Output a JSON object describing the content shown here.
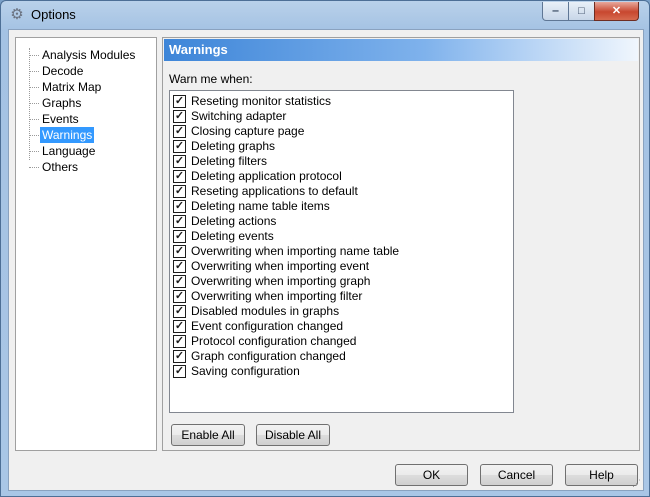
{
  "window": {
    "title": "Options",
    "minimize": "‒",
    "maximize": "□",
    "close": "✕"
  },
  "tree": {
    "items": [
      {
        "label": "Analysis Modules",
        "selected": false
      },
      {
        "label": "Decode",
        "selected": false
      },
      {
        "label": "Matrix Map",
        "selected": false
      },
      {
        "label": "Graphs",
        "selected": false
      },
      {
        "label": "Events",
        "selected": false
      },
      {
        "label": "Warnings",
        "selected": true
      },
      {
        "label": "Language",
        "selected": false
      },
      {
        "label": "Others",
        "selected": false
      }
    ]
  },
  "panel": {
    "header": "Warnings",
    "warn_label": "Warn me when:",
    "check_mark": "✓",
    "items": [
      {
        "label": "Reseting monitor statistics",
        "checked": true
      },
      {
        "label": "Switching adapter",
        "checked": true
      },
      {
        "label": "Closing capture page",
        "checked": true
      },
      {
        "label": "Deleting graphs",
        "checked": true
      },
      {
        "label": "Deleting filters",
        "checked": true
      },
      {
        "label": "Deleting application protocol",
        "checked": true
      },
      {
        "label": "Reseting applications to default",
        "checked": true
      },
      {
        "label": "Deleting name table items",
        "checked": true
      },
      {
        "label": "Deleting actions",
        "checked": true
      },
      {
        "label": "Deleting events",
        "checked": true
      },
      {
        "label": "Overwriting when importing name table",
        "checked": true
      },
      {
        "label": "Overwriting when importing event",
        "checked": true
      },
      {
        "label": "Overwriting when importing graph",
        "checked": true
      },
      {
        "label": "Overwriting when importing filter",
        "checked": true
      },
      {
        "label": "Disabled modules in graphs",
        "checked": true
      },
      {
        "label": "Event configuration changed",
        "checked": true
      },
      {
        "label": "Protocol configuration changed",
        "checked": true
      },
      {
        "label": "Graph configuration changed",
        "checked": true
      },
      {
        "label": "Saving configuration",
        "checked": true
      }
    ],
    "enable_all": "Enable All",
    "disable_all": "Disable All"
  },
  "footer": {
    "ok": "OK",
    "cancel": "Cancel",
    "help": "Help"
  },
  "colors": {
    "selection": "#3399ff",
    "header_start": "#3d85d8"
  }
}
